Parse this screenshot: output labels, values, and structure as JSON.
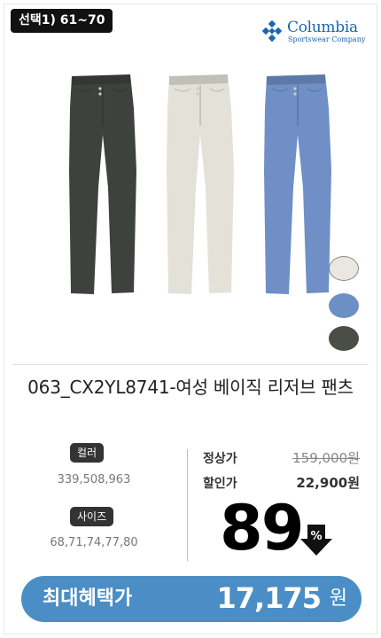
{
  "badge": "선택1) 61~70",
  "brand": {
    "name": "Columbia",
    "sub": "Sportswear Company",
    "color": "#1a66b5"
  },
  "product_colors": [
    "#3d423c",
    "#e3e1d8",
    "#6f8fc6"
  ],
  "swatches": [
    {
      "name": "ivory",
      "color": "#e9e7e0"
    },
    {
      "name": "blue",
      "color": "#6c8fc4"
    },
    {
      "name": "khaki",
      "color": "#4a4e46"
    }
  ],
  "title": "063_CX2YL8741-여성 베이직 리저브 팬츠",
  "options": {
    "color_label": "컬러",
    "color_values": "339,508,963",
    "size_label": "사이즈",
    "size_values": "68,71,74,77,80"
  },
  "price": {
    "regular_label": "정상가",
    "regular_value": "159,000원",
    "sale_label": "할인가",
    "sale_value": "22,900원",
    "discount_rate": "89",
    "percent_symbol": "%"
  },
  "benefit": {
    "label": "최대혜택가",
    "price": "17,175",
    "unit": "원",
    "color": "#4a8ec5"
  }
}
